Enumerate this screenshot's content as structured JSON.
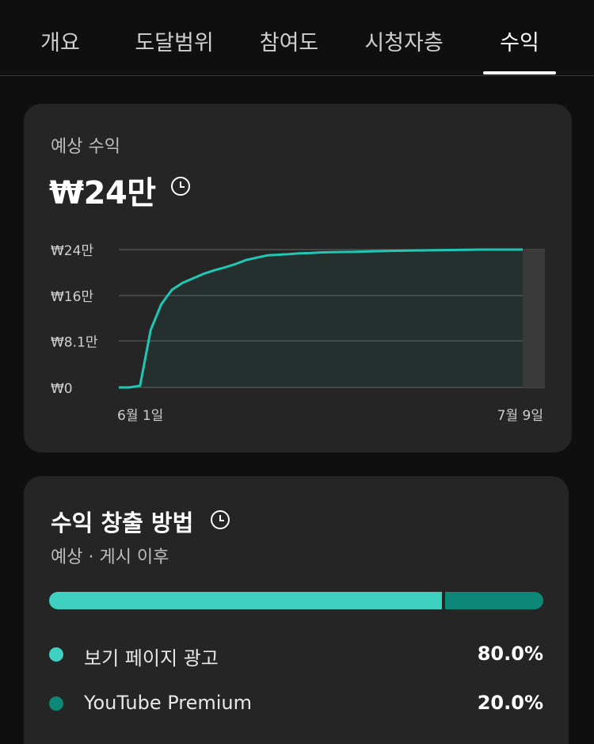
{
  "tabs": [
    {
      "label": "개요"
    },
    {
      "label": "도달범위"
    },
    {
      "label": "참여도"
    },
    {
      "label": "시청자층"
    },
    {
      "label": "수익"
    }
  ],
  "revenue": {
    "label": "예상 수익",
    "value": "₩24만"
  },
  "chart_data": {
    "type": "area",
    "x_start_label": "6월 1일",
    "x_end_label": "7월 9일",
    "yticks": [
      "₩0",
      "₩8.1만",
      "₩16만",
      "₩24만"
    ],
    "ytick_values": [
      0,
      8.1,
      16,
      24
    ],
    "ylim": [
      0,
      24
    ],
    "days": 39,
    "x": [
      0,
      1,
      2,
      3,
      4,
      5,
      6,
      7,
      8,
      9,
      10,
      11,
      12,
      13,
      14,
      15,
      16,
      17,
      18,
      19,
      20,
      22,
      24,
      26,
      28,
      30,
      32,
      34,
      36,
      38
    ],
    "y": [
      0,
      0,
      0.3,
      10,
      14.5,
      17,
      18.2,
      19,
      19.8,
      20.4,
      20.9,
      21.5,
      22.2,
      22.6,
      23,
      23.1,
      23.2,
      23.35,
      23.4,
      23.5,
      23.55,
      23.6,
      23.7,
      23.8,
      23.85,
      23.9,
      23.95,
      24,
      24,
      24
    ],
    "colors": {
      "line": "#20c7b5",
      "fill": "#16a395",
      "grid": "#505050"
    }
  },
  "monetization": {
    "title": "수익 창출 방법",
    "subtitle": "예상 · 게시 이후",
    "segments": [
      {
        "label": "보기 페이지 광고",
        "value": "80.0%",
        "percent": 80,
        "color": "#3ed0c0"
      },
      {
        "label": "YouTube Premium",
        "value": "20.0%",
        "percent": 20,
        "color": "#0d8777"
      }
    ]
  }
}
